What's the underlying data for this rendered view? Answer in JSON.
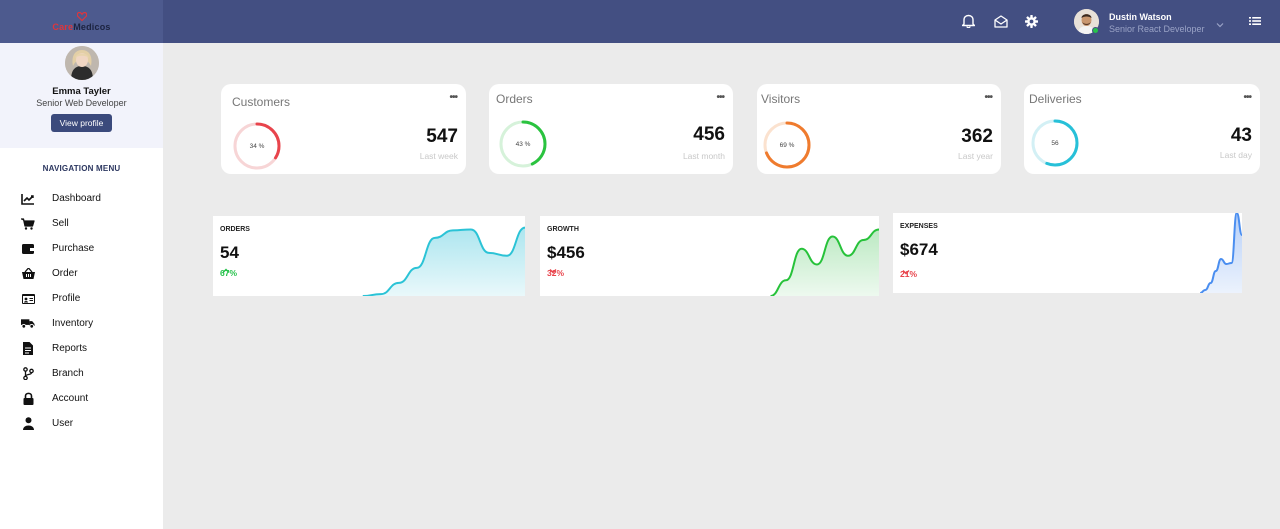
{
  "brand": {
    "care": "Care",
    "medicos": "Medicos"
  },
  "profile": {
    "name": "Emma Tayler",
    "role": "Senior Web Developer",
    "button": "View profile"
  },
  "nav": {
    "title": "NAVIGATION MENU",
    "items": [
      {
        "label": "Dashboard",
        "icon": "chart-line-icon"
      },
      {
        "label": "Sell",
        "icon": "cart-icon"
      },
      {
        "label": "Purchase",
        "icon": "wallet-icon"
      },
      {
        "label": "Order",
        "icon": "basket-icon"
      },
      {
        "label": "Profile",
        "icon": "id-card-icon"
      },
      {
        "label": "Inventory",
        "icon": "truck-icon"
      },
      {
        "label": "Reports",
        "icon": "document-icon"
      },
      {
        "label": "Branch",
        "icon": "branch-icon"
      },
      {
        "label": "Account",
        "icon": "lock-icon"
      },
      {
        "label": "User",
        "icon": "user-icon"
      }
    ]
  },
  "topbar": {
    "icons": [
      "bell-icon",
      "envelope-icon",
      "gear-icon"
    ],
    "user": {
      "name": "Dustin Watson",
      "role": "Senior React Developer"
    }
  },
  "stats": [
    {
      "title": "Customers",
      "value": "547",
      "sub": "Last week",
      "percent_label": "34 %",
      "percent": 34,
      "color": "#e8444c",
      "track": "#f7d5d6"
    },
    {
      "title": "Orders",
      "value": "456",
      "sub": "Last month",
      "percent_label": "43 %",
      "percent": 43,
      "color": "#2ac33f",
      "track": "#d6f2da"
    },
    {
      "title": "Visitors",
      "value": "362",
      "sub": "Last year",
      "percent_label": "69 %",
      "percent": 69,
      "color": "#ef7b2e",
      "track": "#fbe2cf"
    },
    {
      "title": "Deliveries",
      "value": "43",
      "sub": "Last day",
      "percent_label": "56",
      "percent": 56,
      "color": "#27c0d8",
      "track": "#d3f0f5"
    }
  ],
  "area_cards": [
    {
      "title": "ORDERS",
      "value": "54",
      "change": "67%",
      "direction": "up",
      "change_color": "#27c24c",
      "line": "#2bc3d6",
      "fill": "#a8e4ee",
      "values": [
        0,
        2,
        14,
        30,
        62,
        70,
        71,
        46,
        43,
        73
      ]
    },
    {
      "title": "GROWTH",
      "value": "$456",
      "change": "32%",
      "direction": "down",
      "change_color": "#e8444c",
      "line": "#27c23a",
      "fill": "#b8e8bf",
      "values": [
        0,
        18,
        54,
        36,
        68,
        46,
        64,
        76
      ]
    },
    {
      "title": "EXPENSES",
      "value": "$674",
      "change": "21%",
      "direction": "down",
      "change_color": "#e8444c",
      "line": "#4a8ef0",
      "fill": "#b3cdf7",
      "values": [
        0,
        3,
        10,
        22,
        34,
        29,
        30,
        80,
        58
      ]
    }
  ]
}
